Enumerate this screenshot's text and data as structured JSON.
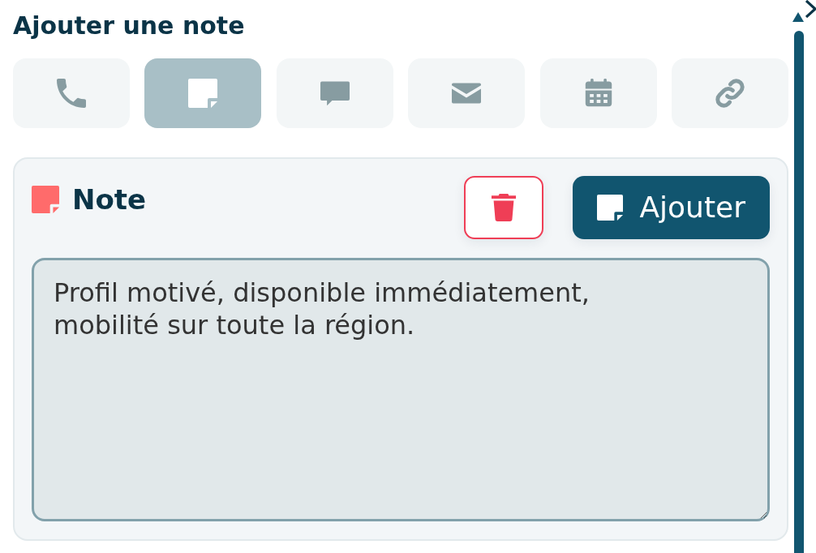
{
  "title": "Ajouter une note",
  "tabs": [
    {
      "kind": "phone",
      "selected": false
    },
    {
      "kind": "note",
      "selected": true
    },
    {
      "kind": "message",
      "selected": false
    },
    {
      "kind": "email",
      "selected": false
    },
    {
      "kind": "calendar",
      "selected": false
    },
    {
      "kind": "link",
      "selected": false
    }
  ],
  "note_panel": {
    "heading": "Note",
    "buttons": [
      {
        "kind": "delete"
      },
      {
        "kind": "add",
        "label": "Ajouter"
      }
    ],
    "text": "Profil motivé, disponible immédiatement, mobilité sur toute la région."
  }
}
